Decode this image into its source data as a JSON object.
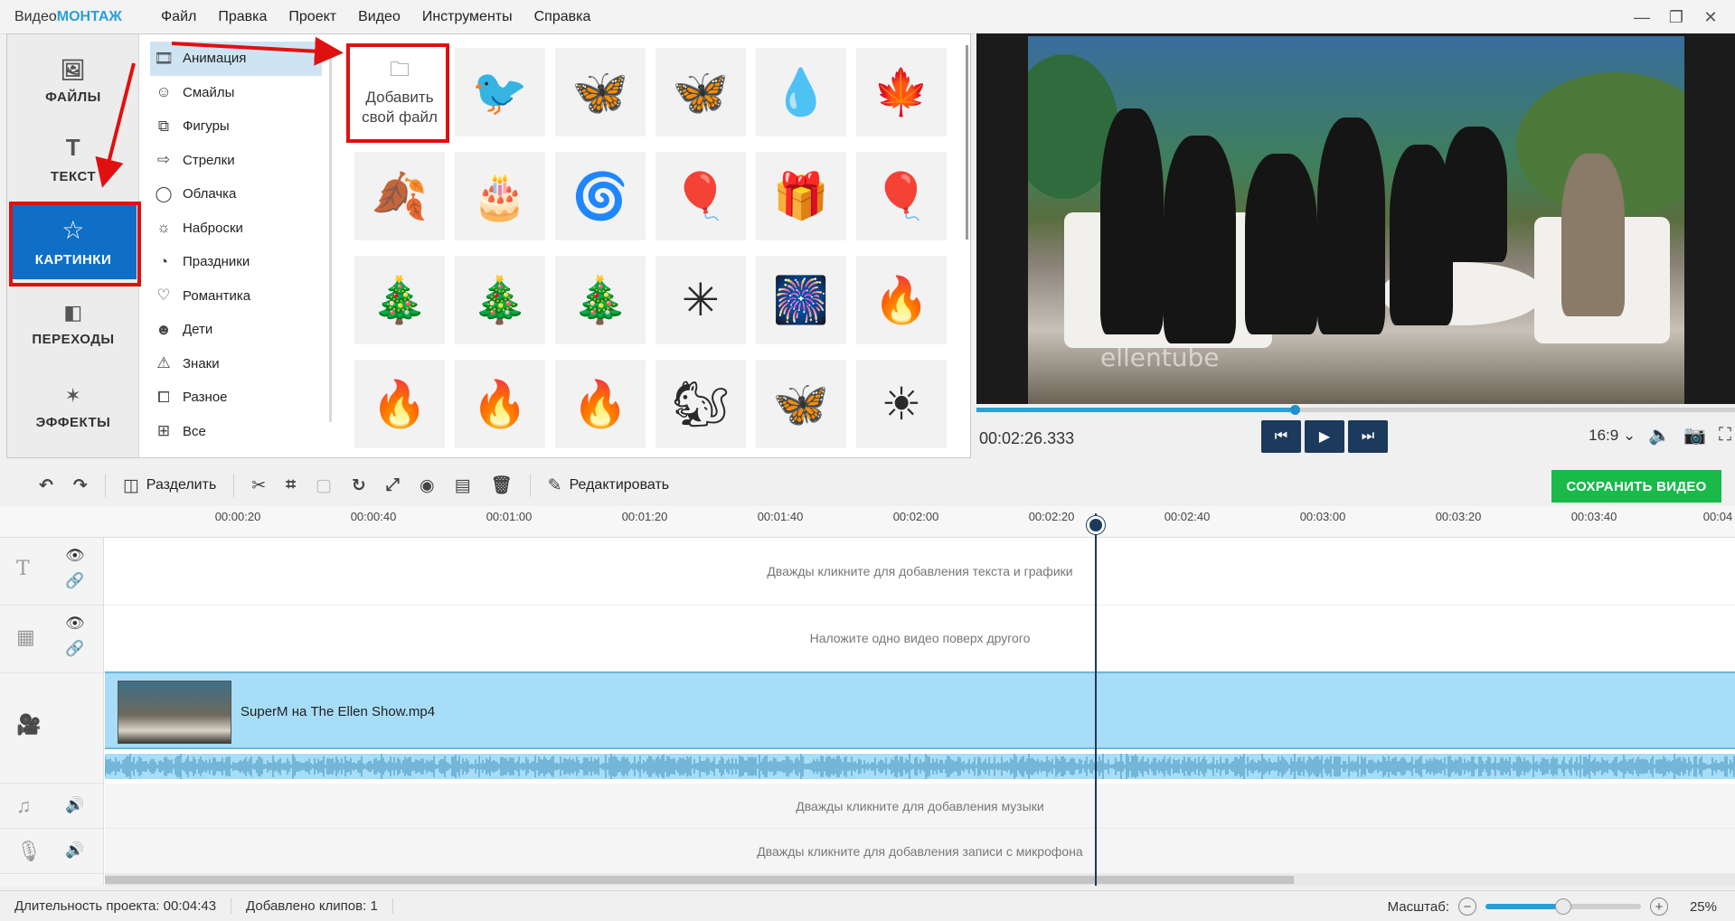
{
  "app": {
    "logo_part1": "Видео",
    "logo_part2": "МОНТАЖ"
  },
  "menu": [
    "Файл",
    "Правка",
    "Проект",
    "Видео",
    "Инструменты",
    "Справка"
  ],
  "window_controls": {
    "minimize": "—",
    "restore": "❐",
    "close": "✕"
  },
  "side_tabs": [
    {
      "label": "ФАЙЛЫ",
      "icon": "🖼",
      "active": false
    },
    {
      "label": "ТЕКСТ",
      "icon": "T",
      "active": false
    },
    {
      "label": "КАРТИНКИ",
      "icon": "☆",
      "active": true
    },
    {
      "label": "ПЕРЕХОДЫ",
      "icon": "◧",
      "active": false
    },
    {
      "label": "ЭФФЕКТЫ",
      "icon": "✶",
      "active": false
    }
  ],
  "categories": [
    {
      "label": "Анимация",
      "icon": "🎞",
      "selected": true
    },
    {
      "label": "Смайлы",
      "icon": "☺",
      "selected": false
    },
    {
      "label": "Фигуры",
      "icon": "⧉",
      "selected": false
    },
    {
      "label": "Стрелки",
      "icon": "⇨",
      "selected": false
    },
    {
      "label": "Облачка",
      "icon": "◯",
      "selected": false
    },
    {
      "label": "Наброски",
      "icon": "☼",
      "selected": false
    },
    {
      "label": "Праздники",
      "icon": "◔",
      "selected": false
    },
    {
      "label": "Романтика",
      "icon": "♡",
      "selected": false
    },
    {
      "label": "Дети",
      "icon": "☻",
      "selected": false
    },
    {
      "label": "Знаки",
      "icon": "⚠",
      "selected": false
    },
    {
      "label": "Разное",
      "icon": "⧠",
      "selected": false
    },
    {
      "label": "Все",
      "icon": "⊞",
      "selected": false
    }
  ],
  "gallery": {
    "add_file_line1": "Добавить",
    "add_file_line2": "свой файл",
    "items": [
      "🐦",
      "🦋",
      "🦋",
      "💧",
      "🍁",
      "🍂",
      "🎂",
      "🌀",
      "🎈",
      "🎁",
      "🎈",
      "🎄",
      "🎄",
      "🎄",
      "✳",
      "🎆",
      "🔥",
      "🔥",
      "🔥",
      "🔥",
      "🐿",
      "🦋",
      "☀"
    ]
  },
  "preview": {
    "watermark": "ellentube",
    "timecode": "00:02:26.333",
    "progress_fraction": 0.42,
    "aspect": "16:9",
    "aspect_chevron": "⌄"
  },
  "toolbar": {
    "split_label": "Разделить",
    "edit_label": "Редактировать",
    "save_label": "СОХРАНИТЬ ВИДЕО"
  },
  "ruler": [
    "00:00:20",
    "00:00:40",
    "00:01:00",
    "00:01:20",
    "00:01:40",
    "00:02:00",
    "00:02:20",
    "00:02:40",
    "00:03:00",
    "00:03:20",
    "00:03:40",
    "00:04"
  ],
  "tracks": {
    "text_hint": "Дважды кликните для добавления текста и графики",
    "overlay_hint": "Наложите одно видео поверх другого",
    "clip_name": "SuperM на The Ellen Show.mp4",
    "music_hint": "Дважды кликните для добавления музыки",
    "mic_hint": "Дважды кликните для добавления записи с микрофона"
  },
  "status": {
    "duration_label": "Длительность проекта:",
    "duration_value": "00:04:43",
    "clips_label": "Добавлено клипов:",
    "clips_value": "1",
    "zoom_label": "Масштаб:",
    "zoom_value": "25%",
    "zoom_fraction": 0.5
  },
  "colors": {
    "accent": "#0f6fc6",
    "save_green": "#19b94a",
    "annotation_red": "#e01010",
    "clip_blue": "#a7ddf7"
  }
}
